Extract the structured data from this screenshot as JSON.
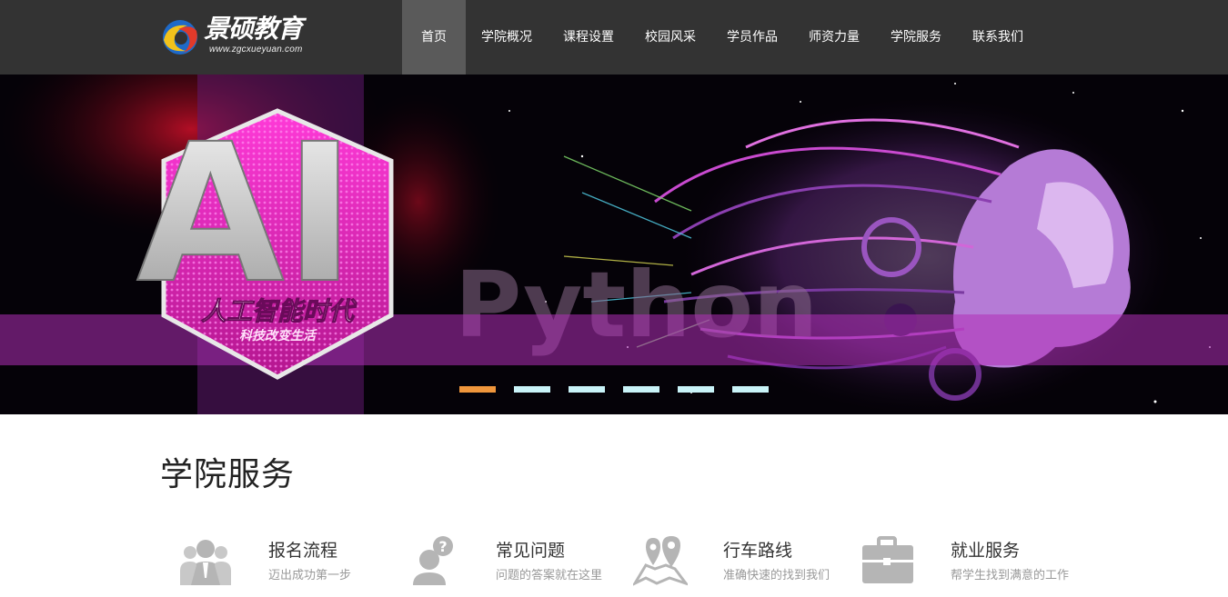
{
  "header": {
    "logo_text": "景硕教育",
    "logo_url": "www.zgcxueyuan.com",
    "nav": [
      {
        "label": "首页",
        "active": true
      },
      {
        "label": "学院概况",
        "active": false
      },
      {
        "label": "课程设置",
        "active": false
      },
      {
        "label": "校园风采",
        "active": false
      },
      {
        "label": "学员作品",
        "active": false
      },
      {
        "label": "师资力量",
        "active": false
      },
      {
        "label": "学院服务",
        "active": false
      },
      {
        "label": "联系我们",
        "active": false
      }
    ]
  },
  "banner": {
    "big_text": "AI",
    "badge_line1": "人工智能时代",
    "badge_line2": "科技改变生活",
    "watermark": "Python",
    "slides": 6,
    "active_slide": 0,
    "colors": {
      "accent_magenta": "#c030c0",
      "dot": "#c9f3f8",
      "dot_active": "#f0963c"
    }
  },
  "services": {
    "title": "学院服务",
    "items": [
      {
        "title": "报名流程",
        "subtitle": "迈出成功第一步",
        "icon": "people-icon"
      },
      {
        "title": "常见问题",
        "subtitle": "问题的答案就在这里",
        "icon": "question-person-icon"
      },
      {
        "title": "行车路线",
        "subtitle": "准确快速的找到我们",
        "icon": "map-pin-icon"
      },
      {
        "title": "就业服务",
        "subtitle": "帮学生找到满意的工作",
        "icon": "briefcase-icon"
      }
    ]
  }
}
